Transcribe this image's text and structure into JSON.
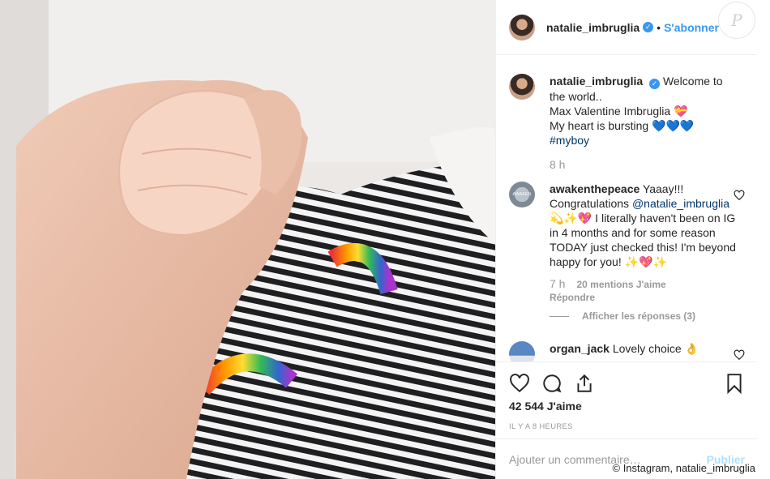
{
  "post": {
    "username": "natalie_imbruglia",
    "verified_mark": "✓",
    "follow_label": "S'abonner",
    "separator": "•",
    "watermark": "P"
  },
  "caption": {
    "username": "natalie_imbruglia",
    "line1": "Welcome to the world..",
    "line2": "Max Valentine Imbruglia 💝",
    "line3_text": "My heart is bursting 💙💙💙 ",
    "hashtag": "#myboy",
    "time": "8 h"
  },
  "comments": [
    {
      "username": "awakenthepeace",
      "avatar_text": "AWAKEN",
      "text_before": "Yaaay!!! Congratulations ",
      "mention": "@natalie_imbruglia",
      "text_after": " 💫✨💖 I literally haven't been on IG in 4 months and for some reason TODAY just checked this! I'm beyond happy for you! ✨💖✨",
      "time": "7 h",
      "likes": "20 mentions J'aime",
      "reply": "Répondre",
      "view_replies": "Afficher les réponses (3)"
    },
    {
      "username": "organ_jack",
      "text": "Lovely choice 👌"
    }
  ],
  "actions": {
    "likes": "42 544 J'aime",
    "time_ago": "IL Y A 8 HEURES"
  },
  "add_comment": {
    "placeholder": "Ajouter un commentaire…",
    "post_label": "Publier"
  },
  "credit": "© Instagram, natalie_imbruglia",
  "colors": {
    "link": "#3897f0",
    "hashtag": "#003569",
    "muted": "#999999"
  }
}
